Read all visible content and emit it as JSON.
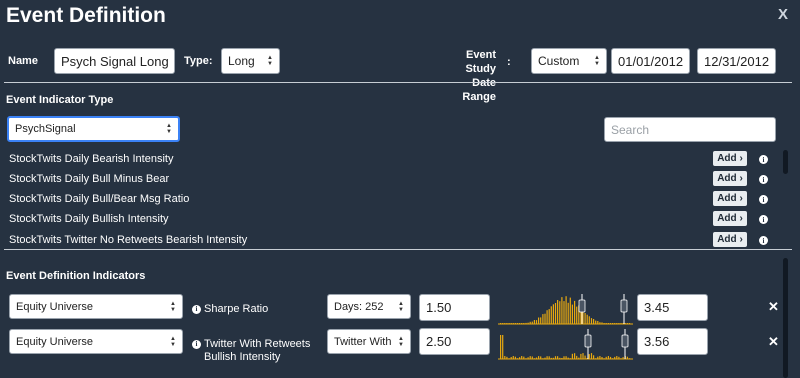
{
  "dialog": {
    "title": "Event Definition",
    "close_label": "X"
  },
  "header": {
    "name_label": "Name",
    "name_value": "Psych Signal Long",
    "type_label": "Type:",
    "type_value": "Long",
    "study_label_line1": "Event Study",
    "study_label_line2": "Date Range",
    "study_colon": ":",
    "range_value": "Custom",
    "start_date": "01/01/2012",
    "end_date": "12/31/2012"
  },
  "indicator_type": {
    "title": "Event Indicator Type",
    "selected": "PsychSignal",
    "search_placeholder": "Search",
    "items": [
      {
        "label": "StockTwits Daily Bearish Intensity",
        "add_label": "Add"
      },
      {
        "label": "StockTwits Daily Bull Minus Bear",
        "add_label": "Add"
      },
      {
        "label": "StockTwits Daily Bull/Bear Msg Ratio",
        "add_label": "Add"
      },
      {
        "label": "StockTwits Daily Bullish Intensity",
        "add_label": "Add"
      },
      {
        "label": "StockTwits Twitter No Retweets Bearish Intensity",
        "add_label": "Add"
      }
    ]
  },
  "definition_indicators": {
    "title": "Event Definition Indicators",
    "rows": [
      {
        "universe": "Equity Universe",
        "label": "Sharpe Ratio",
        "window": "Days: 252",
        "min_value": "1.50",
        "max_value": "3.45",
        "hist_color": "#e8a90f"
      },
      {
        "universe": "Equity Universe",
        "label_line1": "Twitter With Retweets",
        "label_line2": "Bullish Intensity",
        "window": "Twitter With",
        "min_value": "2.50",
        "max_value": "3.56",
        "hist_color": "#e8a90f"
      }
    ]
  },
  "icons": {
    "add_chevron": "chevron-right-icon",
    "info": "info-icon",
    "remove": "close-icon",
    "select_arrows": "select-arrows-icon"
  },
  "colors": {
    "background": "#263241",
    "accent": "#e8a90f",
    "focus": "#3b82f6"
  }
}
